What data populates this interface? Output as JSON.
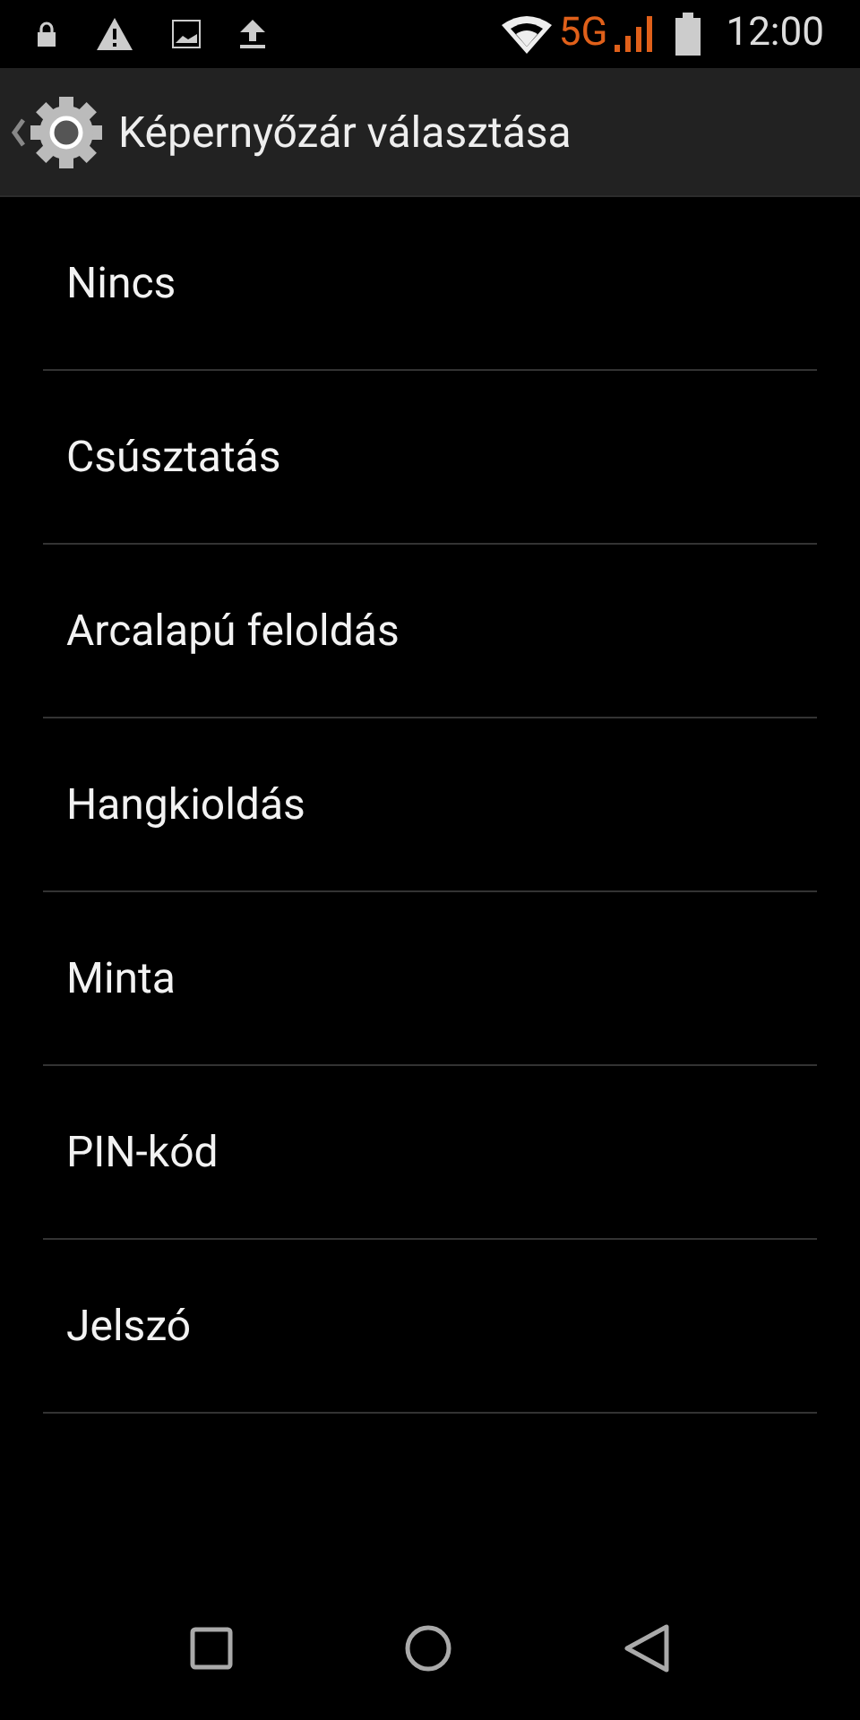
{
  "status_bar": {
    "network": "5G",
    "time": "12:00"
  },
  "action_bar": {
    "title": "Képernyőzár választása"
  },
  "options": [
    "Nincs",
    "Csúsztatás",
    "Arcalapú feloldás",
    "Hangkioldás",
    "Minta",
    "PIN-kód",
    "Jelszó"
  ]
}
